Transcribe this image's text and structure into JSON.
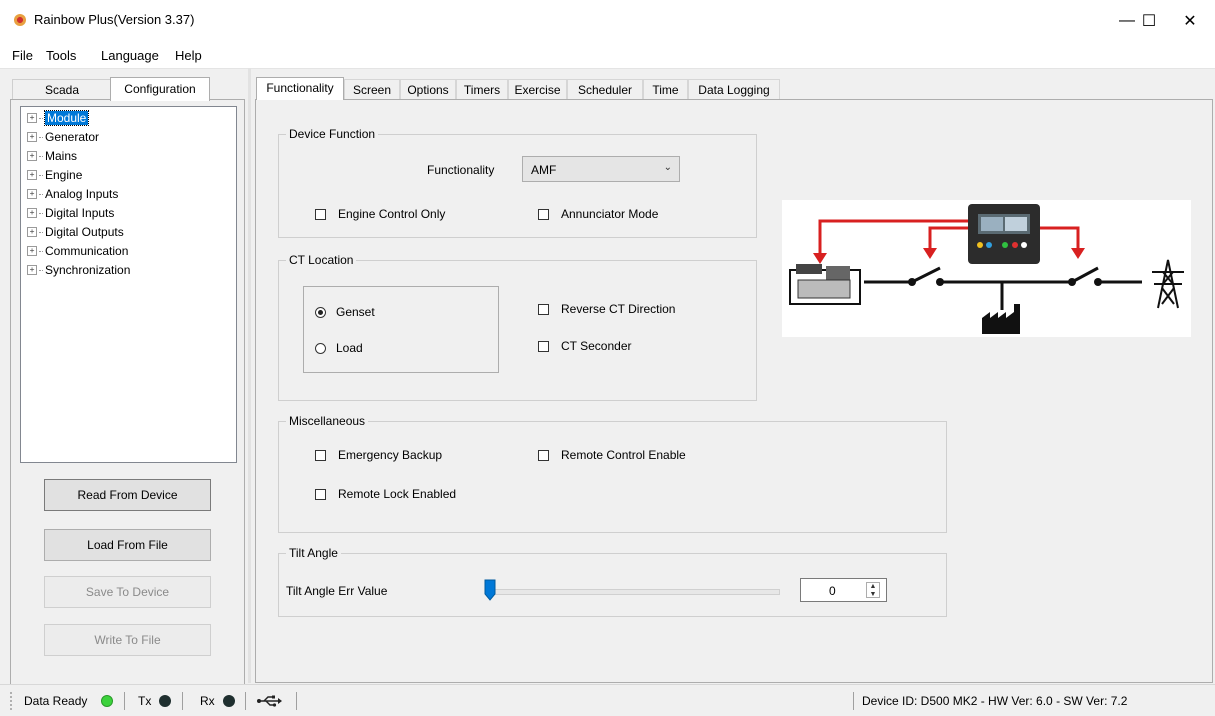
{
  "window": {
    "title": "Rainbow Plus(Version 3.37)",
    "minimize": "—",
    "maximize": "☐",
    "close": "✕"
  },
  "menu": [
    "File",
    "Tools",
    "Language",
    "Help"
  ],
  "left_tabs": {
    "scada": "Scada",
    "configuration": "Configuration"
  },
  "tree": [
    "Module",
    "Generator",
    "Mains",
    "Engine",
    "Analog Inputs",
    "Digital Inputs",
    "Digital Outputs",
    "Communication",
    "Synchronization"
  ],
  "tree_expander": "+",
  "left_buttons": {
    "read": "Read From Device",
    "load": "Load From File",
    "save": "Save To Device",
    "write": "Write To File"
  },
  "right_tabs": [
    "Functionality",
    "Screen",
    "Options",
    "Timers",
    "Exercise",
    "Scheduler",
    "Time",
    "Data Logging"
  ],
  "device_function": {
    "title": "Device Function",
    "functionality_label": "Functionality",
    "functionality_value": "AMF",
    "engine_control_only": "Engine Control Only",
    "annunciator_mode": "Annunciator Mode"
  },
  "ct_location": {
    "title": "CT Location",
    "genset": "Genset",
    "load": "Load",
    "selected": "Genset",
    "reverse_ct": "Reverse CT Direction",
    "ct_seconder": "CT Seconder"
  },
  "misc": {
    "title": "Miscellaneous",
    "emergency_backup": "Emergency Backup",
    "remote_control_enable": "Remote Control Enable",
    "remote_lock_enabled": "Remote Lock Enabled"
  },
  "tilt": {
    "title": "Tilt Angle",
    "label": "Tilt Angle Err Value",
    "value": "0",
    "slider_fraction": 0
  },
  "status": {
    "data_ready": "Data Ready",
    "tx": "Tx",
    "rx": "Rx",
    "device_info": "Device ID: D500 MK2 - HW Ver: 6.0 - SW Ver: 7.2"
  },
  "colors": {
    "accent": "#0078d7",
    "led_green": "#3cd23c",
    "led_dark": "#1f2f2f",
    "diagram_red": "#d82020"
  }
}
